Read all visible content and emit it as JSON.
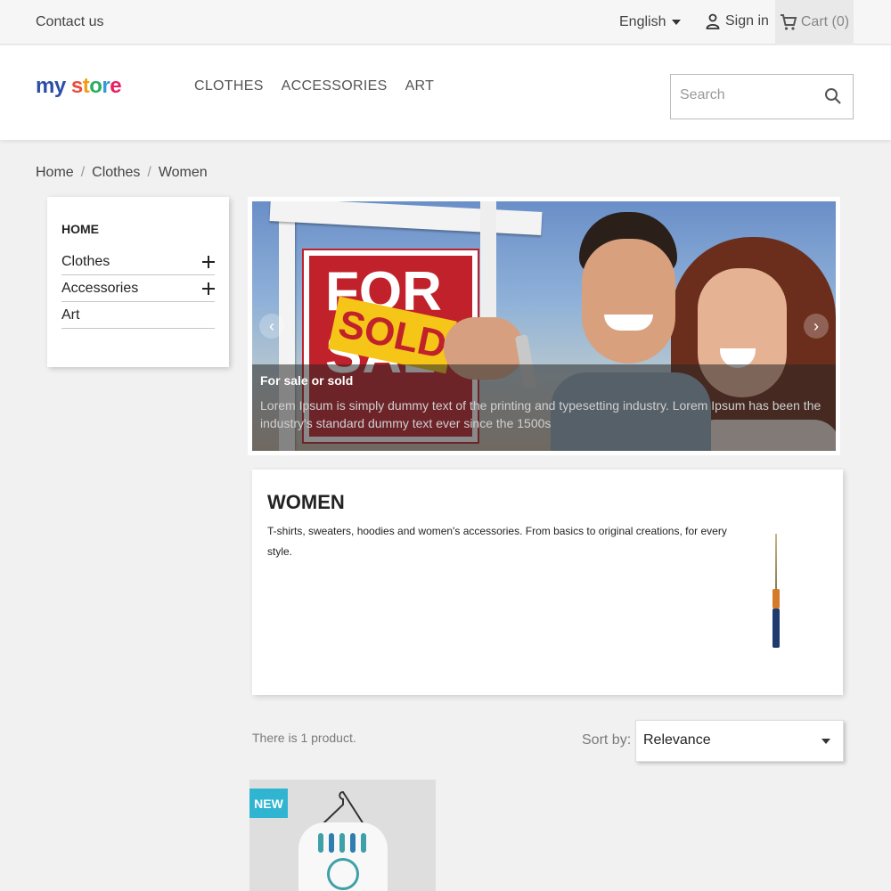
{
  "topbar": {
    "contact": "Contact us",
    "language": "English",
    "signin": "Sign in",
    "cart": "Cart (0)"
  },
  "header": {
    "logo_my": "my",
    "logo_store": "store",
    "nav": [
      "CLOTHES",
      "ACCESSORIES",
      "ART"
    ],
    "search_placeholder": "Search"
  },
  "breadcrumb": [
    "Home",
    "Clothes",
    "Women"
  ],
  "sidebar": {
    "home": "HOME",
    "categories": [
      {
        "label": "Clothes",
        "expandable": true
      },
      {
        "label": "Accessories",
        "expandable": true
      },
      {
        "label": "Art",
        "expandable": false
      }
    ]
  },
  "slider": {
    "sign_top": "FOR",
    "sign_bottom": "SAL",
    "sign_sold": "SOLD",
    "caption_title": "For sale or sold",
    "caption_text": "Lorem Ipsum is simply dummy text of the printing and typesetting industry. Lorem Ipsum has been the industry's standard dummy text ever since the 1500s"
  },
  "category": {
    "title": "WOMEN",
    "description": "T-shirts, sweaters, hoodies and women's accessories. From basics to original creations, for every style."
  },
  "listing": {
    "count_text": "There is 1 product.",
    "sort_label": "Sort by:",
    "sort_value": "Relevance"
  },
  "product": {
    "flag": "NEW"
  },
  "colors": {
    "accent": "#2fb5d2",
    "sign_red": "#c0212b",
    "sold_yellow": "#f5c518"
  },
  "icons": [
    "caret-down-icon",
    "user-icon",
    "cart-icon",
    "search-icon",
    "plus-icon",
    "chevron-left-icon",
    "chevron-right-icon"
  ]
}
